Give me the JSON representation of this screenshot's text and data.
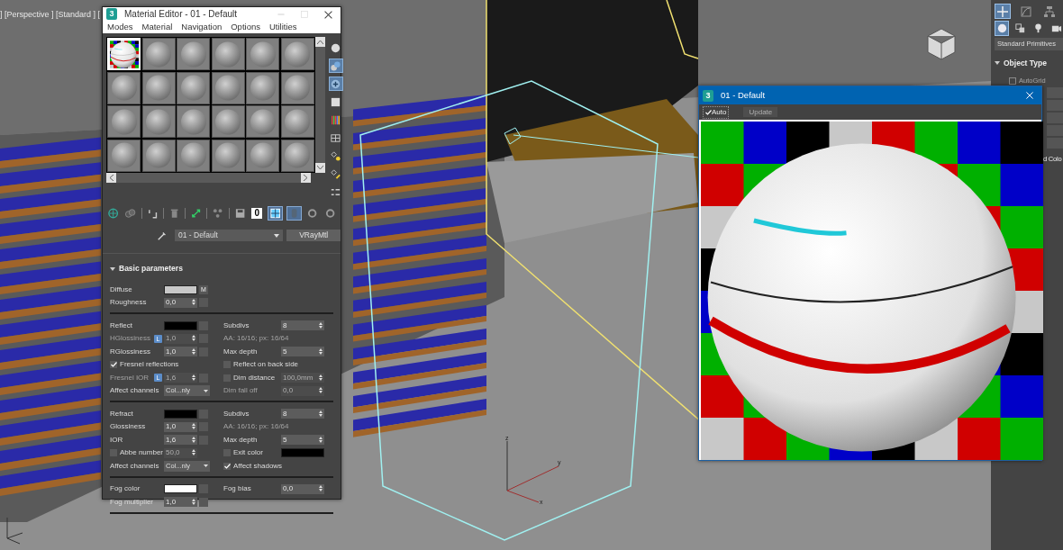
{
  "viewport": {
    "label": "] [Perspective ] [Standard ] [",
    "gizmo_labels": [
      "z",
      "y",
      "x"
    ]
  },
  "material_editor": {
    "app_icon": "3",
    "title": "Material Editor - 01 - Default",
    "menus": [
      "Modes",
      "Material",
      "Navigation",
      "Options",
      "Utilities"
    ],
    "slots": [
      {
        "selected": true
      },
      {
        "selected": false
      },
      {
        "selected": false
      },
      {
        "selected": false
      },
      {
        "selected": false
      },
      {
        "selected": false
      },
      {
        "selected": false
      },
      {
        "selected": false
      },
      {
        "selected": false
      },
      {
        "selected": false
      },
      {
        "selected": false
      },
      {
        "selected": false
      },
      {
        "selected": false
      },
      {
        "selected": false
      },
      {
        "selected": false
      },
      {
        "selected": false
      },
      {
        "selected": false
      },
      {
        "selected": false
      },
      {
        "selected": false
      },
      {
        "selected": false
      },
      {
        "selected": false
      },
      {
        "selected": false
      },
      {
        "selected": false
      },
      {
        "selected": false
      }
    ],
    "side_tools": [
      {
        "active": false
      },
      {
        "active": true
      },
      {
        "active": true
      },
      {
        "active": false
      },
      {
        "active": false
      },
      {
        "active": false
      },
      {
        "active": false
      },
      {
        "active": false
      },
      {
        "active": false
      }
    ],
    "tools": [
      {
        "active": false
      },
      {
        "active": false
      },
      {
        "active": false
      },
      {
        "active": false
      },
      {
        "active": false
      },
      {
        "active": false
      },
      {
        "active": false
      },
      {
        "active": false,
        "label": "0"
      },
      {
        "active": true
      },
      {
        "active": true
      },
      {
        "active": false
      },
      {
        "active": false
      }
    ],
    "material_name": "01 - Default",
    "material_type": "VRayMtl",
    "rollout": {
      "title": "Basic parameters",
      "expanded": true
    },
    "groups": [
      {
        "rows": [
          {
            "left": {
              "kind": "color",
              "label": "Diffuse",
              "color": "#c8c8c8",
              "map": "M",
              "disabled": false
            }
          },
          {
            "left": {
              "kind": "spinner",
              "label": "Roughness",
              "value": "0,0",
              "disabled": false
            }
          }
        ]
      },
      {
        "rows": [
          {
            "left": {
              "kind": "color",
              "label": "Reflect",
              "color": "#000000",
              "disabled": false
            },
            "right": {
              "kind": "spinner",
              "label": "Subdivs",
              "value": "8",
              "disabled": false
            }
          },
          {
            "left": {
              "kind": "spinner",
              "label": "HGlossiness",
              "lock": "L",
              "value": "1,0",
              "disabled": true
            },
            "right": {
              "kind": "info",
              "text": "AA: 16/16; px: 16/64",
              "disabled": true
            }
          },
          {
            "left": {
              "kind": "spinner",
              "label": "RGlossiness",
              "value": "1,0",
              "disabled": false
            },
            "right": {
              "kind": "spinner",
              "label": "Max depth",
              "value": "5",
              "disabled": false
            }
          },
          {
            "left": {
              "kind": "check",
              "label": "Fresnel reflections",
              "checked": true,
              "disabled": false
            },
            "right": {
              "kind": "check",
              "label": "Reflect on back side",
              "checked": false,
              "disabled": false
            }
          },
          {
            "left": {
              "kind": "spinner",
              "label": "Fresnel IOR",
              "lock": "L",
              "value": "1,6",
              "disabled": true
            },
            "right": {
              "kind": "check",
              "label": "Dim distance",
              "checked": false,
              "value": "100,0mm",
              "disabled": false
            }
          },
          {
            "left": {
              "kind": "dropdown",
              "label": "Affect channels",
              "value": "Col...nly",
              "disabled": false
            },
            "right": {
              "kind": "spinner",
              "label": "Dim fall off",
              "value": "0,0",
              "disabled": true
            }
          }
        ]
      },
      {
        "rows": [
          {
            "left": {
              "kind": "color",
              "label": "Refract",
              "color": "#000000",
              "disabled": false
            },
            "right": {
              "kind": "spinner",
              "label": "Subdivs",
              "value": "8",
              "disabled": false
            }
          },
          {
            "left": {
              "kind": "spinner",
              "label": "Glossiness",
              "value": "1,0",
              "disabled": false
            },
            "right": {
              "kind": "info",
              "text": "AA: 16/16; px: 16/64",
              "disabled": true
            }
          },
          {
            "left": {
              "kind": "spinner",
              "label": "IOR",
              "value": "1,6",
              "disabled": false
            },
            "right": {
              "kind": "spinner",
              "label": "Max depth",
              "value": "5",
              "disabled": false
            }
          },
          {
            "left": {
              "kind": "check",
              "label": "Abbe number",
              "checked": false,
              "value": "50,0",
              "disabled": false
            },
            "right": {
              "kind": "check",
              "label": "Exit color",
              "checked": false,
              "color": "#000000",
              "disabled": false
            }
          },
          {
            "left": {
              "kind": "dropdown",
              "label": "Affect channels",
              "value": "Col...nly",
              "disabled": false
            },
            "right": {
              "kind": "check",
              "label": "Affect shadows",
              "checked": true,
              "disabled": false
            }
          }
        ]
      },
      {
        "rows": [
          {
            "left": {
              "kind": "color",
              "label": "Fog color",
              "color": "#ffffff",
              "disabled": false
            },
            "right": {
              "kind": "spinner",
              "label": "Fog bias",
              "value": "0,0",
              "disabled": false
            }
          },
          {
            "left": {
              "kind": "spinner",
              "label": "Fog multiplier",
              "value": "1,0",
              "disabled": false
            }
          }
        ]
      }
    ]
  },
  "preview": {
    "app_icon": "3",
    "title": "01 - Default",
    "auto": {
      "label": "Auto",
      "checked": true
    },
    "update": {
      "label": "Update",
      "disabled": true
    }
  },
  "command_panel": {
    "tabs": [
      {
        "selected": true
      },
      {
        "selected": false
      },
      {
        "selected": false
      }
    ],
    "categories": [
      {
        "selected": true
      },
      {
        "selected": false
      },
      {
        "selected": false
      },
      {
        "selected": false
      }
    ],
    "category": "Standard Primitives",
    "rollout": {
      "title": "Object Type",
      "expanded": true
    },
    "autogrid": {
      "label": "AutoGrid",
      "checked": false,
      "disabled": true
    },
    "rollout_2_title": "d Colo"
  }
}
